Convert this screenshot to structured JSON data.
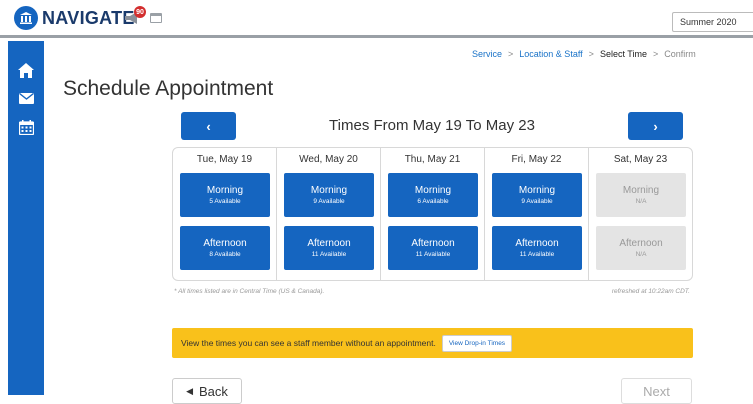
{
  "header": {
    "app_name": "NAVIGATE",
    "notification_count": "90",
    "term_selector": "Summer 2020"
  },
  "breadcrumb": [
    {
      "label": "Service"
    },
    {
      "label": "Location & Staff"
    },
    {
      "label": "Select Time"
    },
    {
      "label": "Confirm"
    }
  ],
  "breadcrumb_sep": ">",
  "page_title": "Schedule Appointment",
  "range_nav": {
    "prev_symbol": "‹",
    "next_symbol": "›",
    "title": "Times From May 19 To May 23"
  },
  "days": [
    {
      "label": "Tue, May 19",
      "morning": {
        "label": "Morning",
        "count": "5 Available"
      },
      "afternoon": {
        "label": "Afternoon",
        "count": "8 Available"
      }
    },
    {
      "label": "Wed, May 20",
      "morning": {
        "label": "Morning",
        "count": "9 Available"
      },
      "afternoon": {
        "label": "Afternoon",
        "count": "11 Available"
      }
    },
    {
      "label": "Thu, May 21",
      "morning": {
        "label": "Morning",
        "count": "6 Available"
      },
      "afternoon": {
        "label": "Afternoon",
        "count": "11 Available"
      }
    },
    {
      "label": "Fri, May 22",
      "morning": {
        "label": "Morning",
        "count": "9 Available"
      },
      "afternoon": {
        "label": "Afternoon",
        "count": "11 Available"
      }
    },
    {
      "label": "Sat, May 23",
      "morning": {
        "label": "Morning",
        "count": "N/A"
      },
      "afternoon": {
        "label": "Afternoon",
        "count": "N/A"
      }
    }
  ],
  "notes": {
    "timezone": "* All times listed are in Central Time (US & Canada).",
    "refreshed": "refreshed at 10:22am CDT."
  },
  "banner": {
    "text": "View the times you can see a staff member without an appointment.",
    "button_label": "View Drop-in Times"
  },
  "footer": {
    "back_symbol": "◀",
    "back_label": "Back",
    "next_label": "Next"
  },
  "colors": {
    "primary": "#1565c0",
    "banner": "#f9c11b",
    "unavailable": "#e4e4e4"
  },
  "icons": {
    "logo": "building-icon",
    "sidebar": [
      "home-icon",
      "mail-icon",
      "calendar-icon"
    ]
  }
}
